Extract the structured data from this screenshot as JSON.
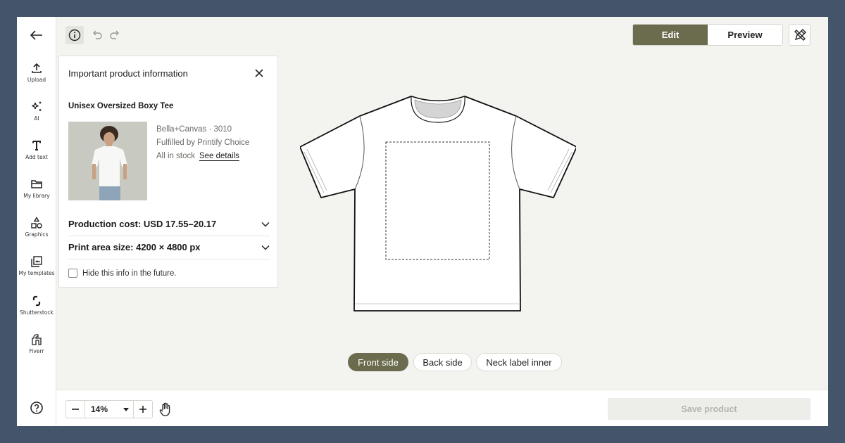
{
  "sidebar": {
    "items": [
      {
        "label": "Upload",
        "icon": "upload-icon"
      },
      {
        "label": "AI",
        "icon": "sparkles-icon"
      },
      {
        "label": "Add text",
        "icon": "text-icon"
      },
      {
        "label": "My library",
        "icon": "folder-icon"
      },
      {
        "label": "Graphics",
        "icon": "shapes-icon"
      },
      {
        "label": "My templates",
        "icon": "templates-icon"
      },
      {
        "label": "Shutterstock",
        "icon": "shutterstock-icon"
      },
      {
        "label": "Fiverr",
        "icon": "fiverr-icon"
      }
    ]
  },
  "header": {
    "edit_label": "Edit",
    "preview_label": "Preview"
  },
  "info_panel": {
    "title": "Important product information",
    "product_name": "Unisex Oversized Boxy Tee",
    "brand_model": "Bella+Canvas · 3010",
    "fulfillment": "Fulfilled by Printify Choice",
    "stock": "All in stock",
    "see_details": "See details",
    "production_cost": "Production cost: USD 17.55–20.17",
    "print_area": "Print area size: 4200 × 4800 px",
    "hide_info": "Hide this info in the future.",
    "hide_checked": false
  },
  "side_tabs": {
    "front": "Front side",
    "back": "Back side",
    "neck": "Neck label inner",
    "selected": "Front side"
  },
  "footer": {
    "zoom": "14%",
    "save_label": "Save product"
  },
  "colors": {
    "accent": "#6b6b4d",
    "canvas_bg": "#f3f3ef",
    "frame_bg": "#44556b"
  }
}
